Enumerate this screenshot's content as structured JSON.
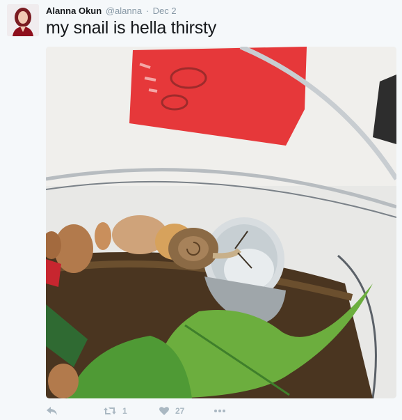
{
  "tweet": {
    "author": {
      "display_name": "Alanna Okun",
      "handle": "@alanna"
    },
    "separator": "·",
    "date": "Dec 2",
    "text": "my snail is hella thirsty"
  },
  "actions": {
    "reply": {
      "icon": "reply-icon"
    },
    "retweet": {
      "icon": "retweet-icon",
      "count": "1"
    },
    "like": {
      "icon": "heart-icon",
      "count": "27"
    },
    "more": {
      "icon": "more-icon"
    }
  },
  "colors": {
    "background": "#f5f8fa",
    "name": "#14171a",
    "meta": "#8899a6",
    "action_icons": "#aab8c2"
  }
}
